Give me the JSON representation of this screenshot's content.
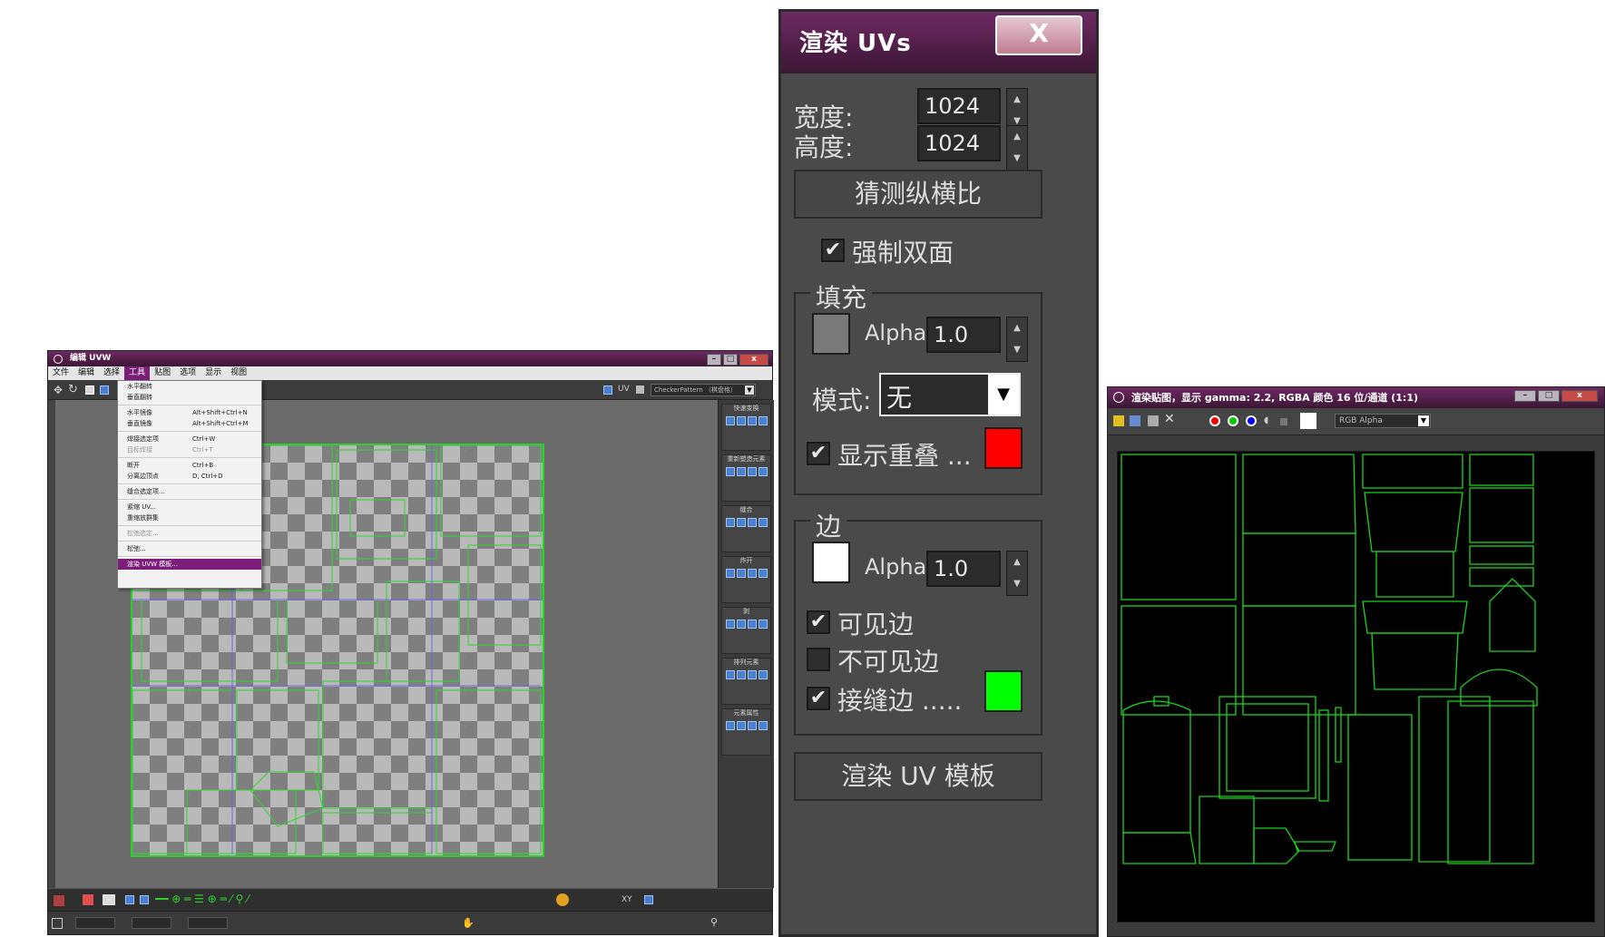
{
  "uvw_editor": {
    "title": "编辑 UVW",
    "menus": [
      "文件",
      "编辑",
      "选择",
      "工具",
      "贴图",
      "选项",
      "显示",
      "视图"
    ],
    "active_menu_index": 3,
    "tools_menu": [
      {
        "label": "水平翻转",
        "key": ""
      },
      {
        "label": "垂直翻转",
        "key": ""
      },
      {
        "sep": true
      },
      {
        "label": "水平镜像",
        "key": "Alt+Shift+Ctrl+N"
      },
      {
        "label": "垂直镜像",
        "key": "Alt+Shift+Ctrl+M"
      },
      {
        "sep": true
      },
      {
        "label": "焊接选定项",
        "key": "Ctrl+W"
      },
      {
        "label": "目标焊接",
        "key": "Ctrl+T",
        "disabled": true
      },
      {
        "sep": true
      },
      {
        "label": "断开",
        "key": "Ctrl+B"
      },
      {
        "label": "分离边顶点",
        "key": "D, Ctrl+D"
      },
      {
        "sep": true
      },
      {
        "label": "缝合选定项...",
        "key": ""
      },
      {
        "sep": true
      },
      {
        "label": "紧缩 UV...",
        "key": ""
      },
      {
        "label": "重缩放群集",
        "key": ""
      },
      {
        "sep": true
      },
      {
        "label": "松弛选定...",
        "key": "",
        "disabled": true
      },
      {
        "sep": true
      },
      {
        "label": "松弛...",
        "key": ""
      },
      {
        "sep": true
      },
      {
        "label": "渲染 UVW 模板...",
        "key": "",
        "selected": true
      }
    ],
    "view_dropdown": "CheckerPattern （棋盘格）",
    "uv_label": "UV",
    "side_panels": [
      "快速变换",
      "重新塑造元素",
      "缝合",
      "炸开",
      "剥",
      "排列元素",
      "元素属性"
    ],
    "status_xy": "XY"
  },
  "render_dialog": {
    "title": "渲染 UVs",
    "close_label": "X",
    "width_label": "宽度:",
    "width_value": "1024",
    "height_label": "高度:",
    "height_value": "1024",
    "guess_aspect_button": "猜测纵横比",
    "force_two_sided": {
      "label": "强制双面",
      "checked": true
    },
    "fill_group": "填充",
    "fill_color": "#7a7a7a",
    "fill_alpha_label": "Alpha:",
    "fill_alpha_value": "1.0",
    "mode_label": "模式:",
    "mode_value": "无",
    "show_overlap": {
      "label": "显示重叠 ...",
      "checked": true
    },
    "overlap_color": "#ff0000",
    "edge_group": "边",
    "edge_color": "#ffffff",
    "edge_alpha_label": "Alpha:",
    "edge_alpha_value": "1.0",
    "visible_edges": {
      "label": "可见边",
      "checked": true
    },
    "invisible_edges": {
      "label": "不可见边",
      "checked": false
    },
    "seam_edges": {
      "label": "接缝边 .....",
      "checked": true
    },
    "seam_color": "#00ff00",
    "render_button": "渲染 UV 模板"
  },
  "bitmap_window": {
    "title": "渲染贴图，显示 gamma: 2.2, RGBA 颜色 16 位/通道 (1:1)",
    "channel_dropdown": "RGB Alpha",
    "channel_dots": [
      "#ff0000",
      "#00cc00",
      "#0000ff"
    ],
    "wire_color": "#19d419"
  }
}
